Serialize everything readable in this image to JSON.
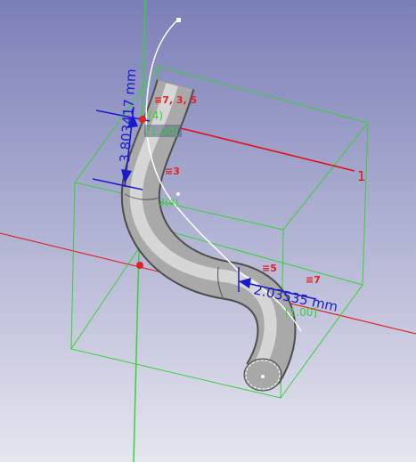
{
  "viewport": {
    "background_top": "#7b7fb7",
    "background_bottom": "#e6e6ef"
  },
  "colors": {
    "bbox": "#37d137",
    "axis": "#e01010",
    "dimension": "#1a1acc",
    "constraint": "#e02222",
    "pipe_light": "#e4e4e4",
    "pipe_dark": "#707070",
    "spline": "#ffffff"
  },
  "dimensions": {
    "vertical": "3.803417 mm",
    "horizontal": "2.03535 mm"
  },
  "constraints": {
    "c1": "≡7, 3, 5",
    "c2": "≡3",
    "c3": "≡5",
    "c4": "≡7",
    "axis_label": "1"
  },
  "weights": {
    "w1": "[1.00]",
    "w2": "[1.00]",
    "index": "(4)",
    "idx2": "3(4)"
  },
  "icons": [
    "constraint-marker-icon",
    "dimension-arrow-icon",
    "control-point-icon"
  ]
}
